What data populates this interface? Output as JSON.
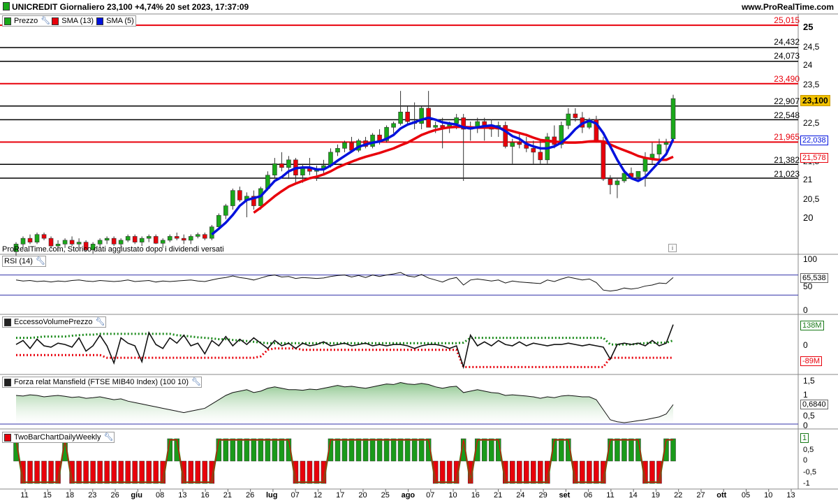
{
  "header": {
    "title": "UNICREDIT Giornaliero 23,100 +4,74% 20 set 2023, 17:37:09",
    "site": "www.ProRealTime.com"
  },
  "price_panel": {
    "legends": [
      {
        "label": "Prezzo",
        "color": "#1aa81a"
      },
      {
        "label": "SMA (13)",
        "color": "#e8000b"
      },
      {
        "label": "SMA (5)",
        "color": "#0011dd"
      }
    ],
    "note": "ProRealTime.com, Storico dati aggiustato dopo i dividendi versati",
    "level_lines": [
      {
        "value": 25.015,
        "label": "25,015",
        "color": "#e8000b"
      },
      {
        "value": 24.432,
        "label": "24,432",
        "color": "#000000"
      },
      {
        "value": 24.073,
        "label": "24,073",
        "color": "#000000"
      },
      {
        "value": 23.49,
        "label": "23,490",
        "color": "#e8000b"
      },
      {
        "value": 22.907,
        "label": "22,907",
        "color": "#000000"
      },
      {
        "value": 22.548,
        "label": "22,548",
        "color": "#000000"
      },
      {
        "value": 21.965,
        "label": "21,965",
        "color": "#e8000b"
      },
      {
        "value": 21.382,
        "label": "21,382",
        "color": "#000000"
      },
      {
        "value": 21.023,
        "label": "21,023",
        "color": "#000000"
      }
    ],
    "y_ticks": [
      "25",
      "24,5",
      "24",
      "23,5",
      "23",
      "22,5",
      "22",
      "21,5",
      "21",
      "20,5",
      "20"
    ],
    "y_tick_values": [
      25,
      24.5,
      24,
      23.5,
      23,
      22.5,
      22,
      21.5,
      21,
      20.5,
      20
    ],
    "last_price": "23,100",
    "sma5_value": "22,038",
    "sma13_value": "21,578"
  },
  "rsi_panel": {
    "legend": "RSI (14)",
    "ticks": [
      "100",
      "50",
      "0"
    ],
    "value": "65,538"
  },
  "evp_panel": {
    "legend": "EccessoVolumePrezzo",
    "ticks": [
      "138M",
      "0",
      "-89M"
    ]
  },
  "mansfield_panel": {
    "legend": "Forza relat Mansfield (FTSE MIB40 Index) (100 10)",
    "ticks": [
      "1,5",
      "1",
      "0,5",
      "0"
    ],
    "value": "0,6840"
  },
  "twobar_panel": {
    "legend": "TwoBarChartDailyWeekly",
    "ticks": [
      "1",
      "0,5",
      "0",
      "-0,5",
      "-1"
    ],
    "value": "1"
  },
  "x_axis": {
    "labels": [
      "11",
      "15",
      "18",
      "23",
      "26",
      "giu",
      "08",
      "13",
      "16",
      "21",
      "26",
      "lug",
      "07",
      "12",
      "17",
      "20",
      "25",
      "ago",
      "07",
      "10",
      "16",
      "21",
      "24",
      "29",
      "set",
      "06",
      "11",
      "14",
      "19",
      "22",
      "27",
      "ott",
      "05",
      "10",
      "13"
    ]
  },
  "chart_data": {
    "type": "candlestick",
    "title": "UNICREDIT Giornaliero",
    "ylim": [
      19.6,
      25.3
    ],
    "series": [
      {
        "name": "SMA (13)",
        "color": "#e8000b"
      },
      {
        "name": "SMA (5)",
        "color": "#0011dd"
      }
    ],
    "candles": [
      [
        19.1,
        19.35,
        19.0,
        19.3
      ],
      [
        19.3,
        19.5,
        19.2,
        19.45
      ],
      [
        19.45,
        19.55,
        19.3,
        19.35
      ],
      [
        19.35,
        19.6,
        19.3,
        19.55
      ],
      [
        19.55,
        19.6,
        19.4,
        19.45
      ],
      [
        19.45,
        19.5,
        19.2,
        19.25
      ],
      [
        19.25,
        19.4,
        19.1,
        19.3
      ],
      [
        19.3,
        19.45,
        19.2,
        19.4
      ],
      [
        19.4,
        19.5,
        19.25,
        19.3
      ],
      [
        19.3,
        19.45,
        19.2,
        19.35
      ],
      [
        19.35,
        19.4,
        19.1,
        19.15
      ],
      [
        19.15,
        19.35,
        19.05,
        19.3
      ],
      [
        19.3,
        19.45,
        19.2,
        19.4
      ],
      [
        19.4,
        19.5,
        19.3,
        19.45
      ],
      [
        19.45,
        19.5,
        19.25,
        19.3
      ],
      [
        19.3,
        19.45,
        19.2,
        19.4
      ],
      [
        19.4,
        19.55,
        19.35,
        19.5
      ],
      [
        19.5,
        19.55,
        19.3,
        19.35
      ],
      [
        19.35,
        19.5,
        19.25,
        19.45
      ],
      [
        19.45,
        19.55,
        19.35,
        19.5
      ],
      [
        19.5,
        19.55,
        19.3,
        19.32
      ],
      [
        19.32,
        19.45,
        19.2,
        19.4
      ],
      [
        19.4,
        19.55,
        19.35,
        19.5
      ],
      [
        19.5,
        19.6,
        19.4,
        19.45
      ],
      [
        19.45,
        19.55,
        19.3,
        19.4
      ],
      [
        19.4,
        19.55,
        19.3,
        19.5
      ],
      [
        19.5,
        19.6,
        19.45,
        19.55
      ],
      [
        19.55,
        19.6,
        19.4,
        19.45
      ],
      [
        19.45,
        19.8,
        19.4,
        19.75
      ],
      [
        19.75,
        20.1,
        19.7,
        20.05
      ],
      [
        20.05,
        20.35,
        19.95,
        20.3
      ],
      [
        20.3,
        20.75,
        20.2,
        20.7
      ],
      [
        20.7,
        20.8,
        20.4,
        20.45
      ],
      [
        20.45,
        20.65,
        20.0,
        20.55
      ],
      [
        20.55,
        20.7,
        20.2,
        20.3
      ],
      [
        20.3,
        20.8,
        20.2,
        20.75
      ],
      [
        20.75,
        21.2,
        20.7,
        21.1
      ],
      [
        21.1,
        21.55,
        21.0,
        21.4
      ],
      [
        21.4,
        21.7,
        21.2,
        21.3
      ],
      [
        21.3,
        21.6,
        21.0,
        21.5
      ],
      [
        21.5,
        21.55,
        20.9,
        21.1
      ],
      [
        21.1,
        21.4,
        20.9,
        21.3
      ],
      [
        21.3,
        21.55,
        21.1,
        21.2
      ],
      [
        21.2,
        21.35,
        20.95,
        21.25
      ],
      [
        21.25,
        21.5,
        21.1,
        21.35
      ],
      [
        21.35,
        21.8,
        21.3,
        21.7
      ],
      [
        21.7,
        21.9,
        21.6,
        21.8
      ],
      [
        21.8,
        22.0,
        21.7,
        21.95
      ],
      [
        21.95,
        22.1,
        21.7,
        21.75
      ],
      [
        21.75,
        22.05,
        21.7,
        22.0
      ],
      [
        22.0,
        22.1,
        21.8,
        21.85
      ],
      [
        21.85,
        22.2,
        21.8,
        22.15
      ],
      [
        22.15,
        22.3,
        21.9,
        22.0
      ],
      [
        22.0,
        22.4,
        21.95,
        22.35
      ],
      [
        22.35,
        22.5,
        22.2,
        22.45
      ],
      [
        22.45,
        23.3,
        22.4,
        22.75
      ],
      [
        22.75,
        22.9,
        22.4,
        22.5
      ],
      [
        22.5,
        23.0,
        22.3,
        22.45
      ],
      [
        22.45,
        22.9,
        22.3,
        22.85
      ],
      [
        22.85,
        23.3,
        22.4,
        22.35
      ],
      [
        22.35,
        22.5,
        22.2,
        22.4
      ],
      [
        22.4,
        22.6,
        21.8,
        22.35
      ],
      [
        22.35,
        22.5,
        22.2,
        22.45
      ],
      [
        22.45,
        22.7,
        22.3,
        22.6
      ],
      [
        22.6,
        22.7,
        20.95,
        22.3
      ],
      [
        22.3,
        22.5,
        22.0,
        22.35
      ],
      [
        22.35,
        22.6,
        22.2,
        22.5
      ],
      [
        22.5,
        22.6,
        22.0,
        22.4
      ],
      [
        22.4,
        22.55,
        22.1,
        22.3
      ],
      [
        22.3,
        22.5,
        22.1,
        22.4
      ],
      [
        22.4,
        22.5,
        21.8,
        21.85
      ],
      [
        21.85,
        22.05,
        21.4,
        21.95
      ],
      [
        21.95,
        22.2,
        21.8,
        21.9
      ],
      [
        21.9,
        22.1,
        21.7,
        21.8
      ],
      [
        21.8,
        22.0,
        21.4,
        21.7
      ],
      [
        21.7,
        22.0,
        21.4,
        21.5
      ],
      [
        21.5,
        22.2,
        21.4,
        22.1
      ],
      [
        22.1,
        22.4,
        21.8,
        21.9
      ],
      [
        21.9,
        22.5,
        21.8,
        22.4
      ],
      [
        22.4,
        22.85,
        22.3,
        22.7
      ],
      [
        22.7,
        22.85,
        22.5,
        22.6
      ],
      [
        22.6,
        22.75,
        22.2,
        22.35
      ],
      [
        22.35,
        22.6,
        22.3,
        22.55
      ],
      [
        22.55,
        22.65,
        21.95,
        22.0
      ],
      [
        22.0,
        22.1,
        20.95,
        21.0
      ],
      [
        21.0,
        21.1,
        20.6,
        20.85
      ],
      [
        20.85,
        21.0,
        20.5,
        20.95
      ],
      [
        20.95,
        21.2,
        20.9,
        21.15
      ],
      [
        21.15,
        21.3,
        21.0,
        21.05
      ],
      [
        21.05,
        21.2,
        20.95,
        21.2
      ],
      [
        21.2,
        21.7,
        20.8,
        21.55
      ],
      [
        21.55,
        21.95,
        21.4,
        21.65
      ],
      [
        21.65,
        22.05,
        21.45,
        21.9
      ],
      [
        21.9,
        22.05,
        21.6,
        21.95
      ],
      [
        22.05,
        23.2,
        22.0,
        23.1
      ]
    ],
    "sma13": [
      19.6,
      19.58,
      19.55,
      19.52,
      19.5,
      19.47,
      19.45,
      19.43,
      19.42,
      19.4,
      19.38,
      19.36,
      19.35,
      19.34,
      19.34,
      19.34,
      19.35,
      19.36,
      19.37,
      19.38,
      19.39,
      19.4,
      19.4,
      19.41,
      19.41,
      19.42,
      19.42,
      19.42,
      19.45,
      19.52,
      19.62,
      19.76,
      19.88,
      20.0,
      20.12,
      20.25,
      20.4,
      20.55,
      20.68,
      20.8,
      20.88,
      20.95,
      21.02,
      21.06,
      21.12,
      21.2,
      21.3,
      21.38,
      21.45,
      21.52,
      21.58,
      21.63,
      21.68,
      21.74,
      21.8,
      21.88,
      21.95,
      22.05,
      22.15,
      22.22,
      22.28,
      22.32,
      22.35,
      22.36,
      22.36,
      22.35,
      22.34,
      22.34,
      22.34,
      22.33,
      22.3,
      22.25,
      22.2,
      22.15,
      22.08,
      22.02,
      22.0,
      21.98,
      21.96,
      21.95,
      21.95,
      21.96,
      21.98,
      21.99,
      21.98,
      21.9,
      21.82,
      21.75,
      21.68,
      21.6,
      21.55,
      21.52,
      21.5,
      21.5,
      21.58
    ],
    "sma5": [
      19.4,
      19.38,
      19.4,
      19.42,
      19.43,
      19.4,
      19.37,
      19.36,
      19.35,
      19.34,
      19.32,
      19.3,
      19.32,
      19.35,
      19.37,
      19.38,
      19.4,
      19.42,
      19.43,
      19.45,
      19.45,
      19.43,
      19.42,
      19.44,
      19.45,
      19.46,
      19.47,
      19.48,
      19.55,
      19.7,
      19.86,
      20.06,
      20.3,
      20.45,
      20.5,
      20.55,
      20.75,
      20.95,
      21.05,
      21.2,
      21.28,
      21.3,
      21.3,
      21.25,
      21.25,
      21.35,
      21.48,
      21.6,
      21.72,
      21.84,
      21.9,
      21.95,
      21.98,
      22.05,
      22.15,
      22.32,
      22.42,
      22.48,
      22.55,
      22.6,
      22.55,
      22.48,
      22.45,
      22.42,
      22.35,
      22.32,
      22.35,
      22.38,
      22.4,
      22.35,
      22.25,
      22.12,
      22.05,
      21.92,
      21.85,
      21.8,
      21.8,
      21.85,
      21.95,
      22.1,
      22.3,
      22.45,
      22.52,
      22.45,
      22.2,
      21.85,
      21.5,
      21.2,
      21.02,
      20.95,
      21.05,
      21.25,
      21.45,
      21.65,
      22.04
    ],
    "rsi": [
      60,
      58,
      59,
      57,
      58,
      56,
      58,
      57,
      59,
      60,
      58,
      57,
      59,
      58,
      57,
      58,
      60,
      57,
      58,
      59,
      56,
      58,
      57,
      58,
      59,
      60,
      58,
      57,
      60,
      63,
      65,
      68,
      65,
      63,
      60,
      64,
      68,
      70,
      66,
      67,
      63,
      65,
      64,
      63,
      64,
      67,
      69,
      70,
      66,
      69,
      65,
      70,
      67,
      70,
      72,
      75,
      68,
      66,
      71,
      64,
      60,
      56,
      62,
      65,
      50,
      60,
      62,
      60,
      58,
      60,
      54,
      58,
      56,
      55,
      54,
      53,
      60,
      57,
      62,
      66,
      63,
      60,
      62,
      55,
      40,
      38,
      40,
      44,
      42,
      44,
      48,
      50,
      54,
      53,
      65
    ],
    "evp": [
      0.05,
      0.2,
      -0.1,
      0.25,
      0.0,
      -0.05,
      0.1,
      0.05,
      -0.05,
      0.3,
      -0.2,
      0.0,
      0.4,
      0.0,
      -0.65,
      0.3,
      0.1,
      0.0,
      -0.6,
      0.5,
      0.05,
      -0.1,
      0.3,
      0.1,
      0.4,
      0.0,
      0.1,
      -0.3,
      0.2,
      0.0,
      0.35,
      0.0,
      0.25,
      0.05,
      0.3,
      0.1,
      -0.1,
      0.2,
      0.0,
      0.1,
      -0.1,
      0.1,
      0.0,
      0.05,
      0.15,
      0.0,
      0.05,
      0.1,
      0.0,
      0.05,
      0.1,
      0.0,
      0.05,
      0.0,
      0.05,
      0.05,
      0.0,
      -0.1,
      0.0,
      0.05,
      0.05,
      0.0,
      -0.1,
      0.0,
      -0.8,
      0.4,
      0.0,
      0.15,
      0.0,
      0.2,
      0.05,
      0.0,
      0.15,
      0.0,
      0.1,
      0.05,
      0.0,
      0.05,
      0.05,
      0.1,
      0.05,
      0.0,
      0.05,
      0.0,
      -0.05,
      -0.5,
      0.05,
      0.1,
      0.05,
      0.1,
      0.0,
      0.2,
      0.0,
      0.1,
      0.8
    ],
    "evp_upper": [
      0.3,
      0.3,
      0.3,
      0.32,
      0.35,
      0.35,
      0.35,
      0.35,
      0.38,
      0.4,
      0.42,
      0.42,
      0.45,
      0.45,
      0.45,
      0.45,
      0.45,
      0.45,
      0.45,
      0.45,
      0.45,
      0.45,
      0.45,
      0.4,
      0.38,
      0.35,
      0.32,
      0.3,
      0.28,
      0.25,
      0.25,
      0.22,
      0.2,
      0.18,
      0.15,
      0.12,
      0.1,
      0.1,
      0.1,
      0.1,
      0.1,
      0.1,
      0.1,
      0.1,
      0.1,
      0.1,
      0.1,
      0.1,
      0.1,
      0.1,
      0.1,
      0.1,
      0.1,
      0.1,
      0.1,
      0.1,
      0.1,
      0.1,
      0.1,
      0.1,
      0.1,
      0.1,
      0.1,
      0.1,
      0.12,
      0.3,
      0.3,
      0.3,
      0.3,
      0.3,
      0.3,
      0.3,
      0.3,
      0.3,
      0.3,
      0.3,
      0.3,
      0.3,
      0.3,
      0.3,
      0.3,
      0.3,
      0.3,
      0.3,
      0.3,
      0.05,
      0.05,
      0.05,
      0.05,
      0.08,
      0.1,
      0.12,
      0.12,
      0.12,
      0.2
    ],
    "evp_lower": [
      -0.35,
      -0.35,
      -0.35,
      -0.35,
      -0.35,
      -0.35,
      -0.35,
      -0.35,
      -0.35,
      -0.35,
      -0.35,
      -0.35,
      -0.35,
      -0.45,
      -0.45,
      -0.45,
      -0.45,
      -0.45,
      -0.45,
      -0.45,
      -0.45,
      -0.45,
      -0.45,
      -0.45,
      -0.45,
      -0.45,
      -0.45,
      -0.45,
      -0.45,
      -0.45,
      -0.45,
      -0.45,
      -0.45,
      -0.45,
      -0.45,
      -0.4,
      -0.15,
      -0.1,
      -0.1,
      -0.1,
      -0.1,
      -0.15,
      -0.15,
      -0.15,
      -0.15,
      -0.15,
      -0.15,
      -0.15,
      -0.15,
      -0.15,
      -0.15,
      -0.15,
      -0.15,
      -0.15,
      -0.15,
      -0.15,
      -0.15,
      -0.15,
      -0.15,
      -0.15,
      -0.15,
      -0.15,
      -0.15,
      -0.15,
      -0.8,
      -0.8,
      -0.8,
      -0.8,
      -0.8,
      -0.8,
      -0.8,
      -0.8,
      -0.8,
      -0.8,
      -0.8,
      -0.8,
      -0.8,
      -0.8,
      -0.8,
      -0.8,
      -0.8,
      -0.8,
      -0.8,
      -0.8,
      -0.8,
      -0.45,
      -0.45,
      -0.45,
      -0.45,
      -0.45,
      -0.45,
      -0.45,
      -0.45,
      -0.45,
      -0.45
    ],
    "mansfield": [
      1.0,
      0.98,
      1.02,
      1.0,
      0.95,
      0.98,
      1.0,
      0.97,
      0.93,
      0.95,
      0.9,
      0.92,
      0.95,
      0.9,
      0.85,
      0.88,
      0.8,
      0.75,
      0.7,
      0.65,
      0.6,
      0.55,
      0.5,
      0.45,
      0.4,
      0.45,
      0.5,
      0.55,
      0.7,
      0.85,
      1.0,
      1.1,
      1.15,
      1.2,
      1.1,
      1.15,
      1.25,
      1.3,
      1.25,
      1.2,
      1.2,
      1.18,
      1.22,
      1.2,
      1.25,
      1.3,
      1.35,
      1.3,
      1.32,
      1.28,
      1.25,
      1.3,
      1.35,
      1.4,
      1.38,
      1.45,
      1.4,
      1.38,
      1.42,
      1.38,
      1.3,
      1.25,
      1.3,
      1.32,
      1.1,
      1.15,
      1.2,
      1.15,
      1.1,
      1.08,
      1.0,
      1.02,
      1.0,
      0.98,
      0.95,
      0.9,
      0.95,
      0.92,
      0.98,
      1.0,
      0.98,
      0.95,
      0.95,
      0.85,
      0.5,
      0.15,
      0.08,
      0.05,
      0.08,
      0.12,
      0.15,
      0.2,
      0.25,
      0.35,
      0.68
    ],
    "twobar": [
      1,
      -1,
      -1,
      -1,
      -1,
      -1,
      -1,
      1,
      -1,
      -1,
      -1,
      -1,
      -1,
      -1,
      -1,
      -1,
      -1,
      -1,
      -1,
      -1,
      -1,
      -1,
      1,
      1,
      -1,
      -1,
      -1,
      -1,
      -1,
      1,
      1,
      1,
      1,
      1,
      1,
      1,
      1,
      1,
      1,
      1,
      -1,
      -1,
      -1,
      -1,
      -1,
      1,
      1,
      1,
      1,
      1,
      1,
      1,
      1,
      1,
      1,
      1,
      1,
      1,
      1,
      1,
      -1,
      -1,
      -1,
      -1,
      1,
      -1,
      1,
      1,
      1,
      1,
      -1,
      -1,
      -1,
      -1,
      -1,
      -1,
      -1,
      1,
      1,
      1,
      -1,
      -1,
      -1,
      -1,
      -1,
      1,
      1,
      1,
      1,
      1,
      -1,
      -1,
      -1,
      1,
      1
    ]
  }
}
